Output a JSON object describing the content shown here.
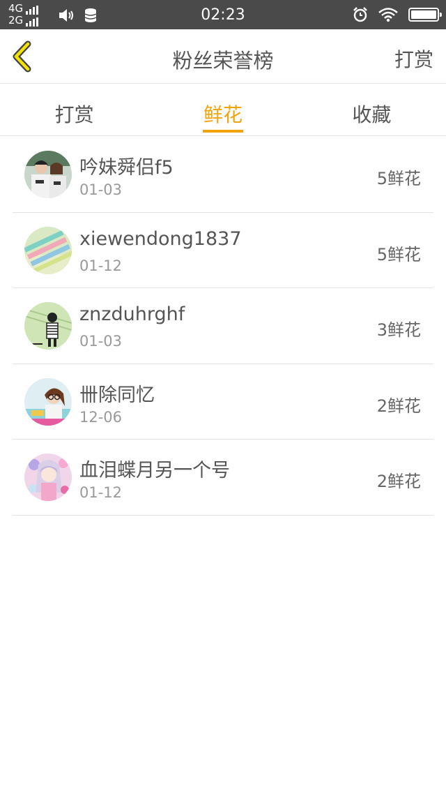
{
  "status_bar": {
    "network_top": "4G",
    "network_bottom": "2G",
    "time": "02:23"
  },
  "header": {
    "title": "粉丝荣誉榜",
    "right_action": "打赏",
    "accent_color": "#f0a30a"
  },
  "tabs": [
    {
      "label": "打赏",
      "active": false
    },
    {
      "label": "鲜花",
      "active": true
    },
    {
      "label": "收藏",
      "active": false
    }
  ],
  "fans": [
    {
      "name": "吟妹舜侣f5",
      "date": "01-03",
      "count": "5鲜花",
      "avatar_icon": "couple-photo-avatar"
    },
    {
      "name": "xiewendong1837",
      "date": "01-12",
      "count": "5鲜花",
      "avatar_icon": "pens-photo-avatar"
    },
    {
      "name": "znzduhrghf",
      "date": "01-03",
      "count": "3鲜花",
      "avatar_icon": "sketch-person-avatar"
    },
    {
      "name": "卌除同忆",
      "date": "12-06",
      "count": "2鲜花",
      "avatar_icon": "girl-glasses-avatar"
    },
    {
      "name": "血泪蝶月另一个号",
      "date": "01-12",
      "count": "2鲜花",
      "avatar_icon": "anime-girl-avatar"
    }
  ]
}
